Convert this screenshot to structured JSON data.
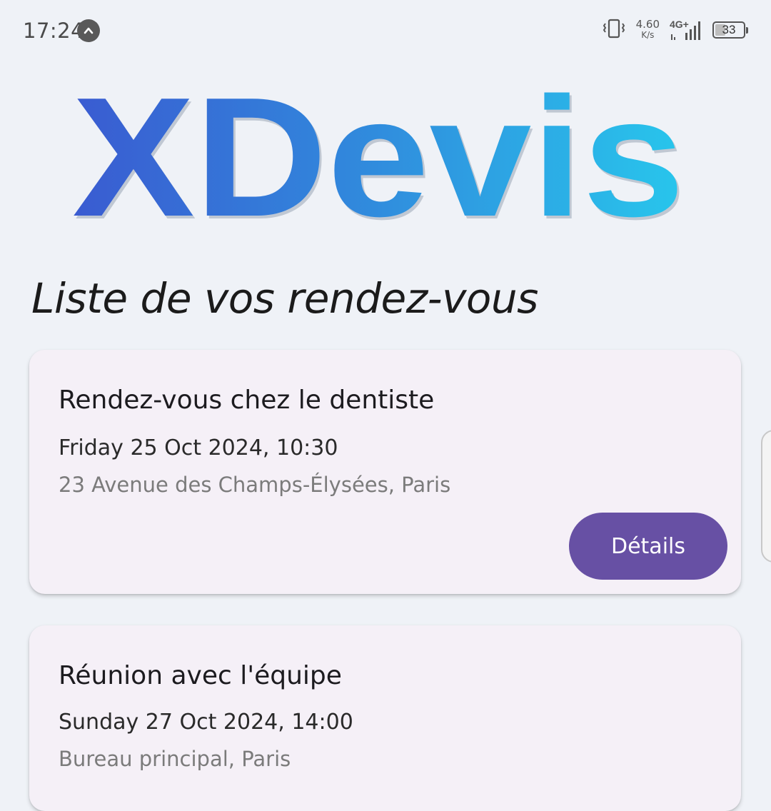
{
  "status_bar": {
    "time": "17:24",
    "net_speed_value": "4.60",
    "net_speed_unit": "K/s",
    "network_type": "4G+",
    "battery_level": "33",
    "icons": [
      "app-notification-icon",
      "vibrate-icon",
      "signal-icon",
      "battery-icon"
    ]
  },
  "app": {
    "logo_text": "XDevis",
    "logo_gradient": [
      "#3a5bd1",
      "#2fa6e2",
      "#28c6ec"
    ]
  },
  "main": {
    "heading": "Liste de vos rendez-vous",
    "appointments": [
      {
        "title": "Rendez-vous chez le dentiste",
        "datetime": "Friday 25 Oct 2024, 10:30",
        "address": "23 Avenue des Champs-Élysées, Paris",
        "button_label": "Détails"
      },
      {
        "title": "Réunion avec l'équipe",
        "datetime": "Sunday 27 Oct 2024, 14:00",
        "address": "Bureau principal, Paris"
      }
    ]
  },
  "colors": {
    "background": "#eff2f7",
    "card": "#f5f0f7",
    "primary_button": "#6750a4"
  }
}
